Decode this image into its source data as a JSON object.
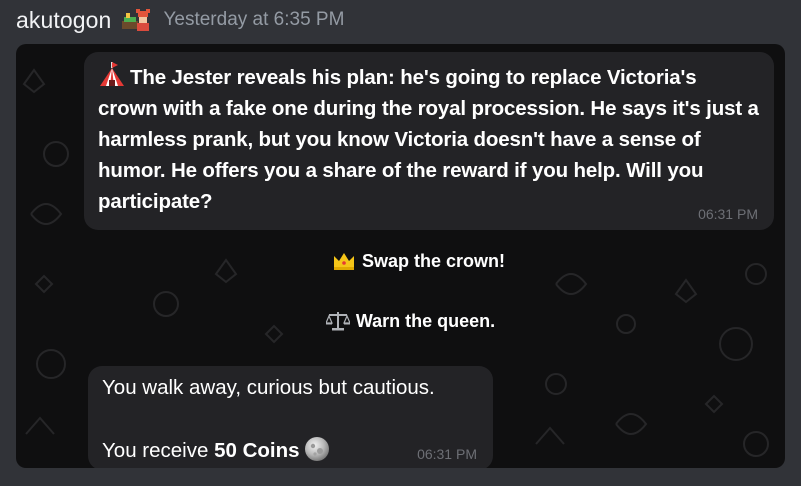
{
  "message": {
    "username": "akutogon",
    "badge_icon": "pixel-character-badge",
    "timestamp": "Yesterday at 6:35 PM"
  },
  "chat": {
    "story_bubble": {
      "icon": "circus-tent-icon",
      "text": "The Jester reveals his plan: he's going to replace Victoria's crown with a fake one during the royal procession. He says it's just a harmless prank, but you know Victoria doesn't have a sense of humor. He offers you a share of the reward if you help. Will you participate?",
      "time": "06:31 PM"
    },
    "options": [
      {
        "icon": "crown-icon",
        "label": "Swap the crown!"
      },
      {
        "icon": "scales-icon",
        "label": "Warn the queen."
      }
    ],
    "result_bubble": {
      "line1": "You walk away, curious but cautious.",
      "line2_prefix": "You receive ",
      "amount_label": "50 Coins",
      "coin_icon": "coin-icon",
      "time": "06:31 PM"
    }
  }
}
